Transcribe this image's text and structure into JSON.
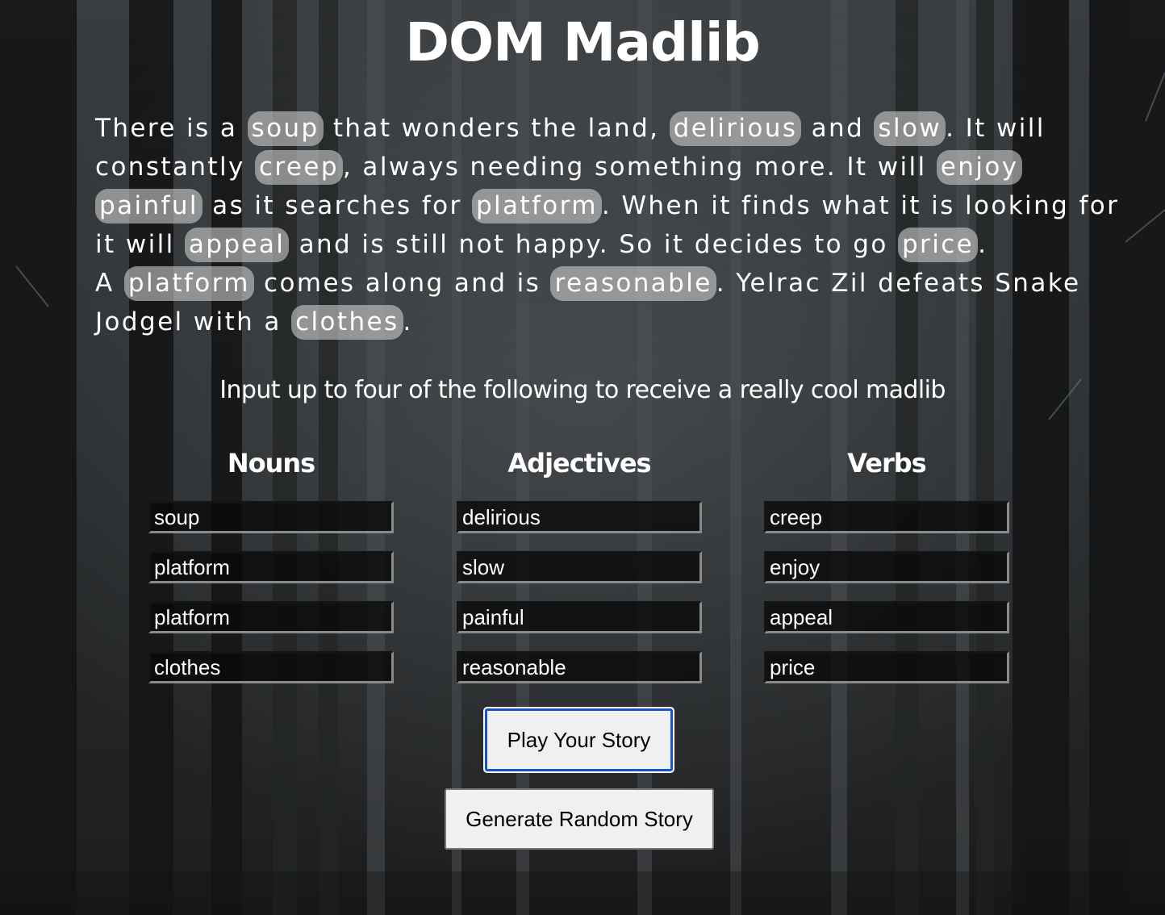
{
  "page": {
    "title": "DOM Madlib",
    "instructions": "Input up to four of the following to receive a really cool madlib"
  },
  "story": {
    "line1": {
      "t1": "There is a ",
      "w1": "soup",
      "t2": " that wonders the land, ",
      "w2": "delirious",
      "t3": " and ",
      "w3": "slow",
      "t4": ". It will"
    },
    "line2": {
      "t1": "constantly ",
      "w1": "creep",
      "t2": ", always needing something more. It will ",
      "w2": "enjoy"
    },
    "line3": {
      "w1": "painful",
      "t1": " as it searches for ",
      "w2": "platform",
      "t2": ". When it finds what it is looking for"
    },
    "line4": {
      "t1": "it will ",
      "w1": "appeal",
      "t2": " and is still not happy. So it decides to go ",
      "w2": "price",
      "t3": "."
    },
    "line5": {
      "t1": "A ",
      "w1": "platform",
      "t2": " comes along and is ",
      "w2": "reasonable",
      "t3": ". Yelrac Zil defeats Snake"
    },
    "line6": {
      "t1": "Jodgel with a ",
      "w1": "clothes",
      "t2": "."
    }
  },
  "nouns": {
    "heading": "Nouns",
    "values": [
      "soup",
      "platform",
      "platform",
      "clothes"
    ]
  },
  "adjectives": {
    "heading": "Adjectives",
    "values": [
      "delirious",
      "slow",
      "painful",
      "reasonable"
    ]
  },
  "verbs": {
    "heading": "Verbs",
    "values": [
      "creep",
      "enjoy",
      "appeal",
      "price"
    ]
  },
  "buttons": {
    "play": "Play Your Story",
    "random": "Generate Random Story"
  },
  "colors": {
    "pill_background": "#cdcdcd",
    "focus_ring": "#1655c9"
  }
}
